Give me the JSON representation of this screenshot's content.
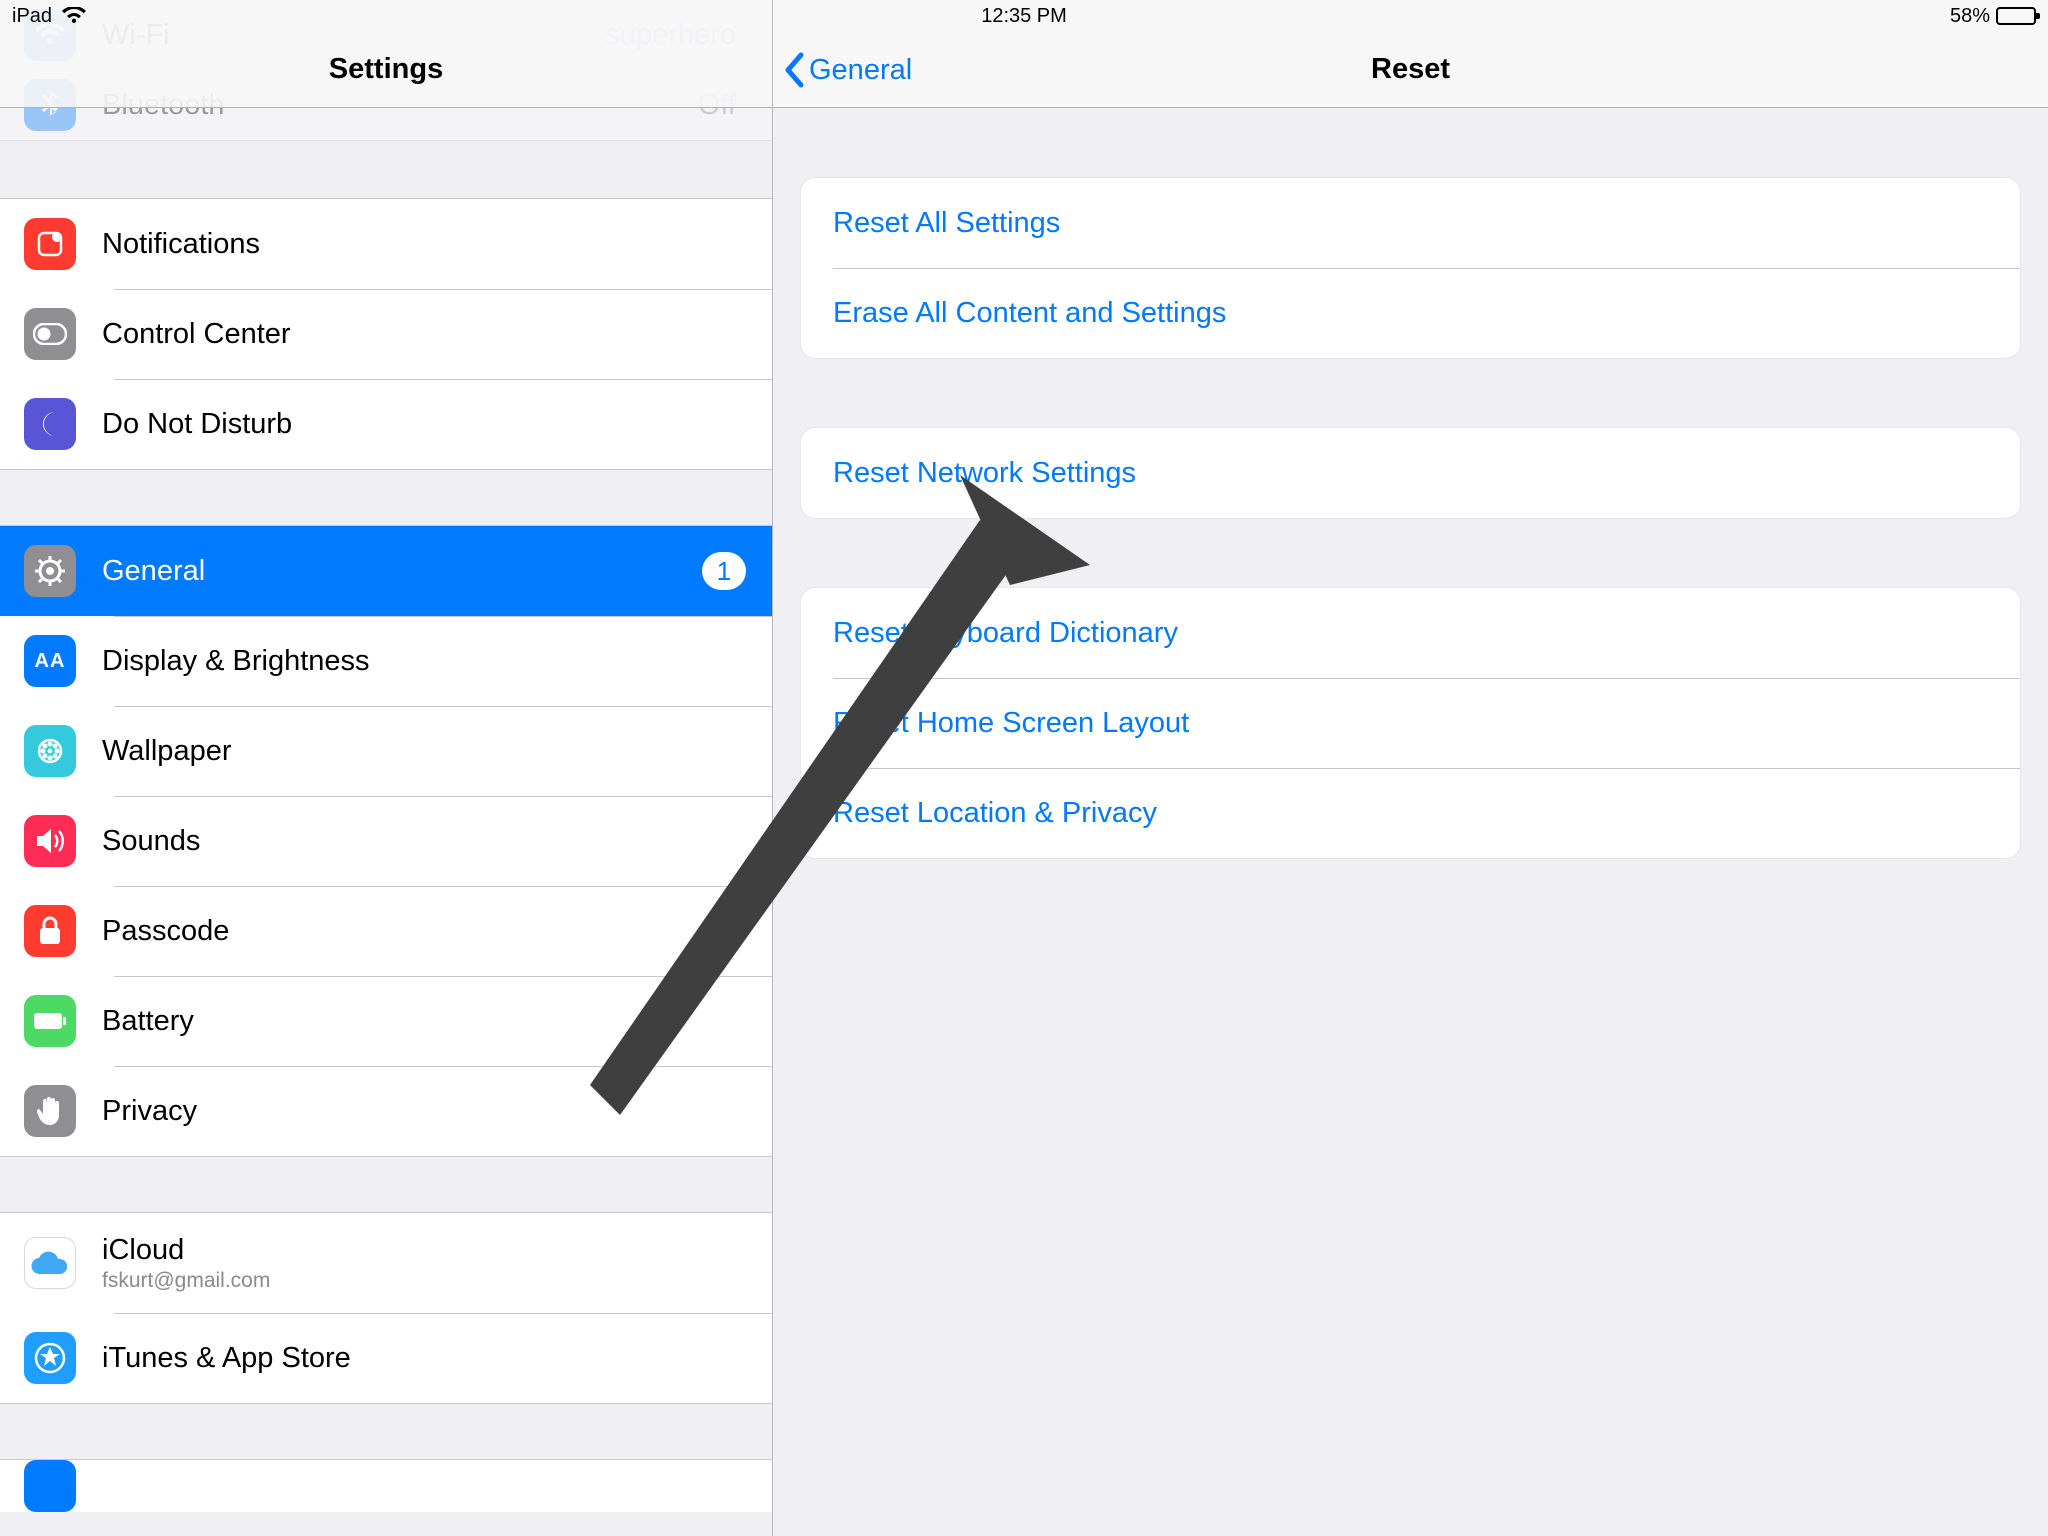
{
  "status": {
    "carrier": "iPad",
    "time": "12:35 PM",
    "battery_text": "58%"
  },
  "sidebar": {
    "title": "Settings",
    "ghost": {
      "wifi_label": "Wi-Fi",
      "wifi_value": "superhero",
      "bt_label": "Bluetooth",
      "bt_value": "Off"
    },
    "group1": [
      {
        "label": "Notifications"
      },
      {
        "label": "Control Center"
      },
      {
        "label": "Do Not Disturb"
      }
    ],
    "group2": [
      {
        "label": "General",
        "badge": "1"
      },
      {
        "label": "Display & Brightness"
      },
      {
        "label": "Wallpaper"
      },
      {
        "label": "Sounds"
      },
      {
        "label": "Passcode"
      },
      {
        "label": "Battery"
      },
      {
        "label": "Privacy"
      }
    ],
    "group3": [
      {
        "label": "iCloud",
        "sub": "fskurt@gmail.com"
      },
      {
        "label": "iTunes & App Store"
      }
    ]
  },
  "detail": {
    "back_label": "General",
    "title": "Reset",
    "g1": [
      "Reset All Settings",
      "Erase All Content and Settings"
    ],
    "g2": [
      "Reset Network Settings"
    ],
    "g3": [
      "Reset Keyboard Dictionary",
      "Reset Home Screen Layout",
      "Reset Location & Privacy"
    ]
  }
}
